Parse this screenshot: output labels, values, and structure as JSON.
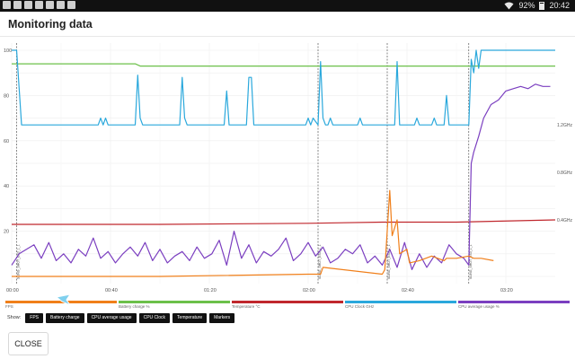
{
  "status_bar": {
    "time": "20:42",
    "battery": "92%",
    "icons": [
      "notification-icons"
    ]
  },
  "title": "Monitoring data",
  "chart_data": {
    "type": "line",
    "x_ticks": [
      "00:00",
      "00:40",
      "01:20",
      "02:00",
      "02:40",
      "03:20"
    ],
    "x_tick_seconds": [
      0,
      40,
      80,
      120,
      160,
      200
    ],
    "x_range": [
      0,
      220
    ],
    "y_left_ticks": [
      "100",
      "80",
      "60",
      "40",
      "20"
    ],
    "y_left_range": [
      0,
      100
    ],
    "y_right_ticks": [
      "1.2GHz",
      "0.8GHz",
      "0.4GHz"
    ],
    "grid": true,
    "markers": [
      {
        "t": 2,
        "label": "SLING_SHOT_ES3_1_1"
      },
      {
        "t": 124,
        "label": "SLING_SHOT_ES3_1_1"
      },
      {
        "t": 152,
        "label": "SLING_SHOT_ES3_1_1"
      },
      {
        "t": 185,
        "label": "SLING_SHOT_ES3_1_1"
      }
    ],
    "series": [
      {
        "name": "Battery charge %",
        "color": "#6cc04a",
        "x": [
          0,
          50,
          52,
          220
        ],
        "y": [
          94,
          94,
          93,
          93
        ]
      },
      {
        "name": "Temperature °C",
        "color": "#c0272d",
        "x": [
          0,
          60,
          120,
          150,
          180,
          220
        ],
        "y": [
          23,
          23,
          23.5,
          24,
          24,
          25
        ]
      },
      {
        "name": "CPU Clock GHz",
        "color": "#2aa8dc",
        "x": [
          0,
          2,
          4,
          35,
          36,
          37,
          38,
          39,
          50,
          51,
          52,
          53,
          54,
          68,
          69,
          70,
          71,
          72,
          86,
          87,
          88,
          95,
          96,
          97,
          98,
          119,
          120,
          121,
          122,
          124,
          125,
          126,
          127,
          128,
          129,
          130,
          140,
          141,
          142,
          155,
          156,
          157,
          163,
          164,
          165,
          170,
          171,
          172,
          175,
          176,
          177,
          185,
          186,
          187,
          188,
          189,
          190,
          191,
          220
        ],
        "y": [
          100,
          100,
          67,
          67,
          70,
          67,
          70,
          67,
          67,
          89,
          70,
          67,
          67,
          67,
          88,
          70,
          67,
          67,
          67,
          82,
          67,
          67,
          88,
          88,
          67,
          67,
          70,
          67,
          70,
          67,
          95,
          70,
          67,
          67,
          70,
          67,
          67,
          70,
          67,
          67,
          95,
          67,
          67,
          70,
          67,
          67,
          70,
          67,
          67,
          80,
          67,
          67,
          96,
          90,
          100,
          92,
          100,
          100,
          100
        ]
      },
      {
        "name": "CPU average usage %",
        "color": "#7b3fc0",
        "x": [
          0,
          3,
          6,
          9,
          12,
          15,
          18,
          21,
          24,
          27,
          30,
          33,
          36,
          39,
          42,
          45,
          48,
          51,
          54,
          57,
          60,
          63,
          66,
          69,
          72,
          75,
          78,
          81,
          84,
          87,
          90,
          93,
          96,
          99,
          102,
          105,
          108,
          111,
          114,
          117,
          120,
          123,
          126,
          129,
          132,
          135,
          138,
          141,
          144,
          147,
          150,
          153,
          156,
          159,
          162,
          165,
          168,
          171,
          174,
          177,
          180,
          183,
          185,
          186,
          187,
          189,
          191,
          194,
          197,
          200,
          203,
          206,
          209,
          212,
          215,
          218
        ],
        "y": [
          5,
          10,
          12,
          14,
          8,
          15,
          7,
          10,
          6,
          12,
          9,
          17,
          8,
          11,
          6,
          10,
          13,
          9,
          15,
          7,
          12,
          6,
          9,
          11,
          7,
          13,
          8,
          10,
          16,
          5,
          20,
          8,
          14,
          6,
          11,
          9,
          12,
          17,
          7,
          10,
          15,
          9,
          13,
          6,
          8,
          12,
          10,
          14,
          6,
          9,
          5,
          12,
          4,
          15,
          3,
          10,
          4,
          9,
          6,
          14,
          10,
          8,
          5,
          50,
          55,
          62,
          70,
          76,
          78,
          82,
          83,
          84,
          83,
          85,
          84,
          84
        ]
      },
      {
        "name": "FPS",
        "color": "#f07f1a",
        "x": [
          0,
          60,
          120,
          125,
          126,
          150,
          151,
          153,
          154,
          156,
          157,
          160,
          161,
          165,
          170,
          175,
          176,
          180,
          185,
          187,
          190,
          195
        ],
        "y": [
          0,
          0,
          1,
          1,
          4,
          1,
          3,
          38,
          18,
          25,
          10,
          12,
          6,
          7,
          9,
          7,
          8,
          8,
          9,
          8,
          8,
          7
        ]
      }
    ]
  },
  "legend": [
    {
      "label": "FPS",
      "color": "#f07f1a"
    },
    {
      "label": "Battery charge %",
      "color": "#6cc04a"
    },
    {
      "label": "Temperature °C",
      "color": "#c0272d"
    },
    {
      "label": "CPU Clock GHz",
      "color": "#2aa8dc"
    },
    {
      "label": "CPU average usage %",
      "color": "#7b3fc0"
    }
  ],
  "show": {
    "label": "Show:",
    "chips": [
      "FPS",
      "Battery charge",
      "CPU average usage",
      "CPU Clock",
      "Temperature",
      "Markers"
    ]
  },
  "close_label": "CLOSE"
}
